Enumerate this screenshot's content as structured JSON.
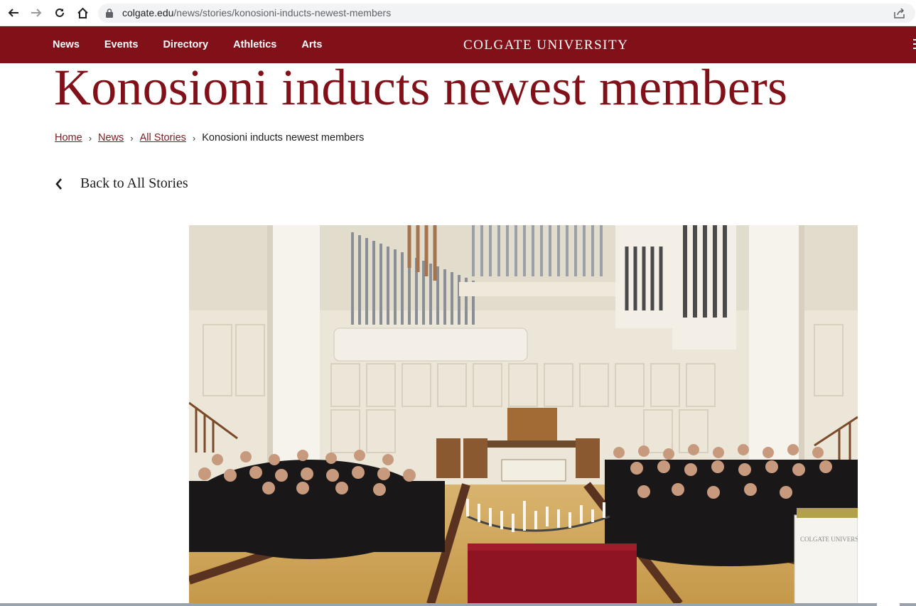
{
  "browser": {
    "url_domain": "colgate.edu",
    "url_path": "/news/stories/konosioni-inducts-newest-members",
    "icons": [
      "back-arrow-icon",
      "forward-arrow-icon",
      "reload-icon",
      "home-icon",
      "lock-icon",
      "share-icon"
    ]
  },
  "header": {
    "nav": [
      "News",
      "Events",
      "Directory",
      "Athletics",
      "Arts"
    ],
    "logo": "COLGATE UNIVERSITY",
    "brand_color": "#821019"
  },
  "article": {
    "title": "Konosioni inducts newest members",
    "breadcrumb": [
      "Home",
      "News",
      "All Stories"
    ],
    "breadcrumb_current": "Konosioni inducts newest members",
    "back_label": "Back to All Stories"
  }
}
